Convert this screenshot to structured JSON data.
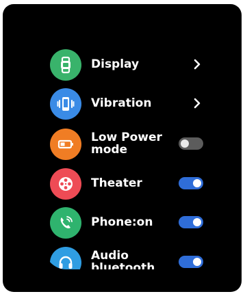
{
  "settings": {
    "items": [
      {
        "label": "Display",
        "control": "chevron",
        "icon": "watch-icon",
        "icon_color": "#39b36b"
      },
      {
        "label": "Vibration",
        "control": "chevron",
        "icon": "vibration-icon",
        "icon_color": "#3a8be6"
      },
      {
        "label": "Low Power mode",
        "control": "toggle",
        "state": "off",
        "icon": "battery-icon",
        "icon_color": "#f07d24"
      },
      {
        "label": "Theater",
        "control": "toggle",
        "state": "on",
        "icon": "film-reel-icon",
        "icon_color": "#ee4b55"
      },
      {
        "label": "Phone:on",
        "control": "toggle",
        "state": "on",
        "icon": "phone-icon",
        "icon_color": "#2fb36e"
      },
      {
        "label": "Audio bluetooth",
        "control": "toggle",
        "state": "on",
        "icon": "headphones-icon",
        "icon_color": "#2f9de2"
      }
    ]
  },
  "colors": {
    "toggle_on": "#2f6dd8",
    "toggle_off": "#5c5c5c",
    "background": "#000000",
    "text": "#ffffff"
  }
}
